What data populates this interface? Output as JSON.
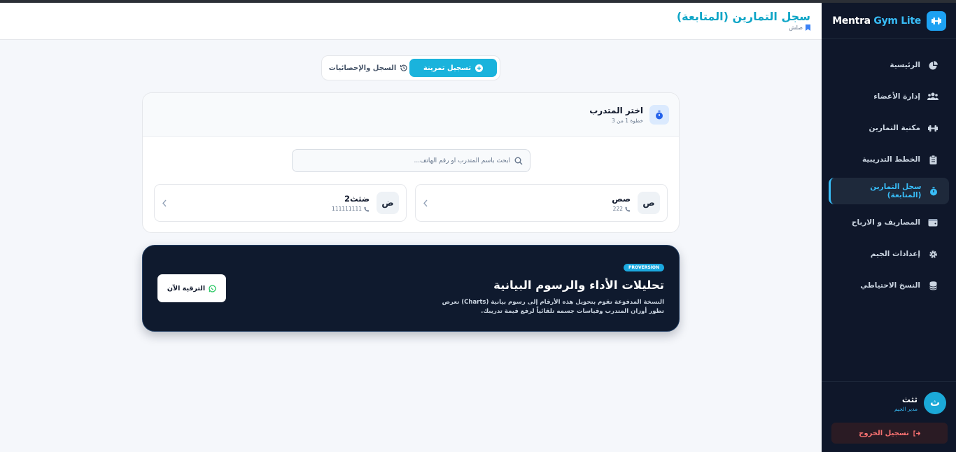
{
  "brand": {
    "name_white": "Mentra ",
    "name_blue": "Gym Lite"
  },
  "nav": [
    {
      "label": "الرئيسية",
      "icon": "pie-chart-icon"
    },
    {
      "label": "إدارة الأعضاء",
      "icon": "users-icon"
    },
    {
      "label": "مكتبة التمارين",
      "icon": "dumbbell-icon"
    },
    {
      "label": "الخطط التدريبية",
      "icon": "clipboard-icon"
    },
    {
      "label": "سجل التمارين (المتابعة)",
      "icon": "stopwatch-icon",
      "active": true
    },
    {
      "label": "المصاريف و الارباح",
      "icon": "wallet-icon"
    },
    {
      "label": "إعدادات الجيم",
      "icon": "gear-icon"
    },
    {
      "label": "النسخ الاحتياطي",
      "icon": "database-icon"
    }
  ],
  "user": {
    "initial": "ث",
    "name": "ثثث",
    "role": "مدير الجيم"
  },
  "logout_label": "تسجيل الخروج",
  "header": {
    "title": "سجل التمارين (المتابعة)",
    "breadcrumb": "صلش"
  },
  "tabs": {
    "active": "تسجيل تمرينة",
    "inactive": "السجل والإحصائيات"
  },
  "step_card": {
    "title": "اختر المتدرب",
    "subtitle": "خطوة 1 من 3",
    "search_placeholder": "ابحث باسم المتدرب أو رقم الهاتف..."
  },
  "members": [
    {
      "initial": "ص",
      "name": "صص",
      "phone": "222"
    },
    {
      "initial": "ض",
      "name": "ضثث2",
      "phone": "111111111"
    }
  ],
  "promo": {
    "badge": "PROVERSION",
    "title": "تحليلات الأداء والرسوم البيانية",
    "description": "النسخة المدفوعة تقوم بتحويل هذه الأرقام إلى رسوم بيانية (Charts) تعرض تطور أوزان المتدرب وقياسات جسمه تلقائياً لرفع قيمة تدريبك.",
    "button": "الترقية الآن"
  },
  "colors": {
    "sidebar_bg": "#0f172a",
    "accent": "#1ab3dc",
    "promo_bg": "#0f1a2e",
    "logout": "#f87171"
  }
}
